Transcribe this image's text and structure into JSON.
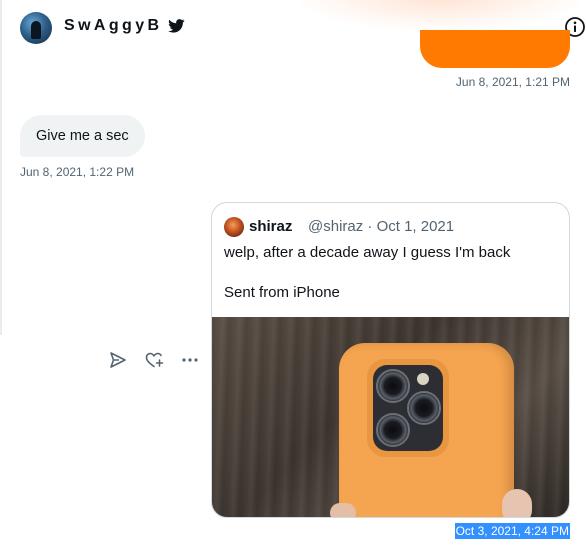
{
  "header": {
    "name": "SwAggyB",
    "bird_icon": "twitter-bird-icon",
    "info_icon": "info-icon"
  },
  "messages": {
    "sent_1": {
      "time": "Jun 8, 2021, 1:21 PM",
      "color": "#ff7a00"
    },
    "received_1": {
      "text": "Give me a sec",
      "time": "Jun 8, 2021, 1:22 PM"
    },
    "sent_2": {
      "quote": {
        "name": "shiraz",
        "handle_date": "@shiraz · Oct 1, 2021",
        "text_line1": "welp, after a decade away I guess I'm back",
        "text_line2": "Sent from iPhone",
        "photo": "orange-iphone-photo"
      },
      "time": "Oct 3, 2021, 4:24 PM"
    }
  },
  "actions": {
    "share_icon": "send-icon",
    "react_icon": "heart-plus-icon",
    "more_icon": "more-horizontal-icon"
  },
  "colors": {
    "accent_orange": "#ff7a00",
    "selection": "#3390ff",
    "received_bg": "#eff3f4"
  }
}
